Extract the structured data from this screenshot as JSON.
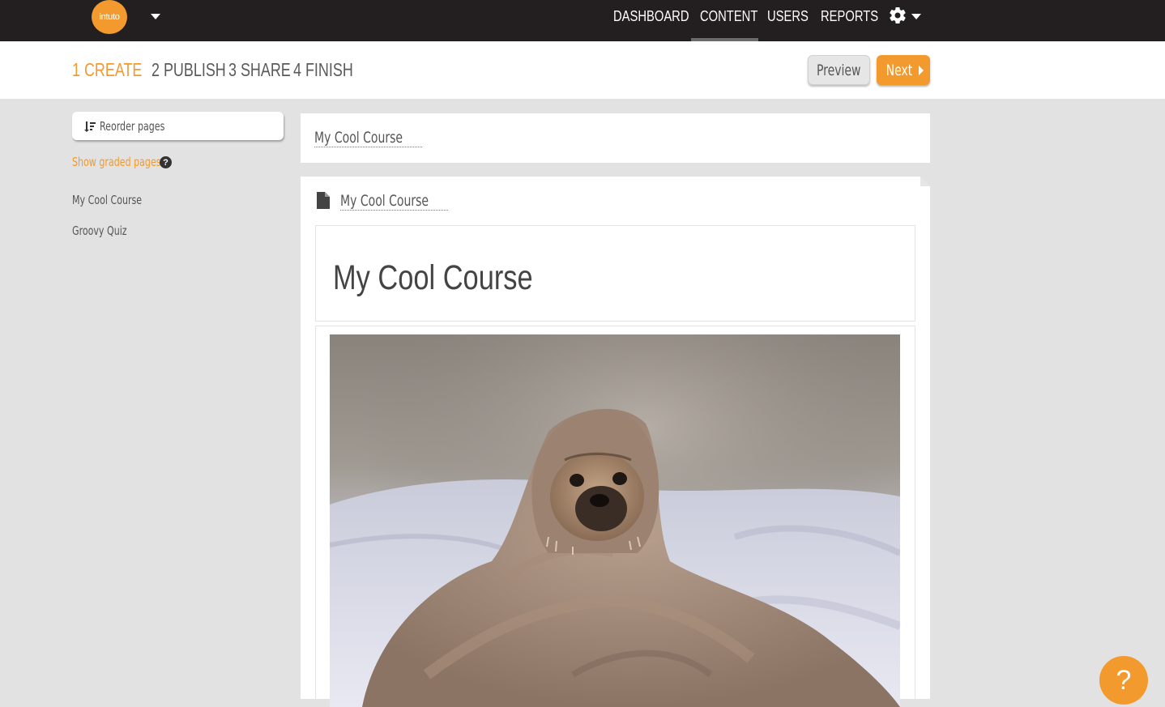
{
  "brand": {
    "logo_text": "intuto",
    "accent": "#f39a2e"
  },
  "nav": {
    "items": [
      "DASHBOARD",
      "CONTENT",
      "USERS",
      "REPORTS"
    ],
    "active": "CONTENT",
    "settings_icon": "gear-icon"
  },
  "steps": {
    "items": [
      {
        "num": "1",
        "label": "CREATE",
        "active": true
      },
      {
        "num": "2",
        "label": "PUBLISH",
        "active": false
      },
      {
        "num": "3",
        "label": "SHARE",
        "active": false
      },
      {
        "num": "4",
        "label": "FINISH",
        "active": false
      }
    ],
    "preview_label": "Preview",
    "next_label": "Next"
  },
  "sidebar": {
    "reorder_label": "Reorder pages",
    "graded_label": "Show graded pages",
    "help_glyph": "?",
    "pages": [
      "My Cool Course",
      "Groovy Quiz"
    ]
  },
  "main": {
    "course_title": "My Cool Course",
    "page_title": "My Cool Course",
    "heading": "My Cool Course",
    "image_subject": "pug wrapped in blanket"
  },
  "help_fab": "?"
}
